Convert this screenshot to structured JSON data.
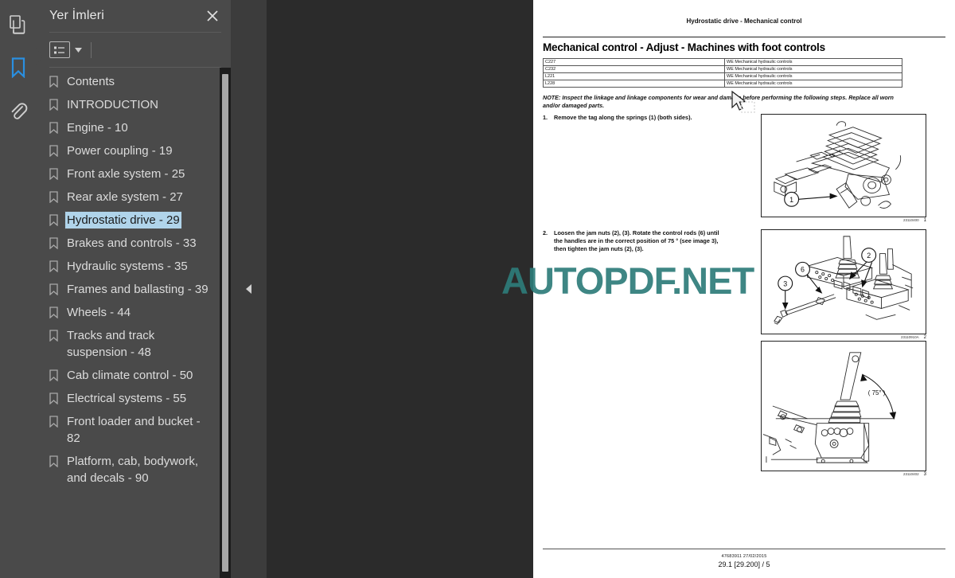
{
  "rail": {
    "items": [
      {
        "name": "pages-icon",
        "tooltip": "Sayfa Küçük Resimleri",
        "active": false
      },
      {
        "name": "bookmark-icon",
        "tooltip": "Yer İmleri",
        "active": true
      },
      {
        "name": "attachment-icon",
        "tooltip": "Ekler",
        "active": false
      }
    ]
  },
  "panel": {
    "title": "Yer İmleri",
    "close_label": "×",
    "toolbar": {
      "list_options_label": "",
      "caret_label": ""
    },
    "bookmarks": [
      {
        "label": "Contents",
        "selected": false
      },
      {
        "label": "INTRODUCTION",
        "selected": false
      },
      {
        "label": "Engine - 10",
        "selected": false
      },
      {
        "label": "Power coupling - 19",
        "selected": false
      },
      {
        "label": "Front axle system - 25",
        "selected": false
      },
      {
        "label": "Rear axle system - 27",
        "selected": false
      },
      {
        "label": "Hydrostatic drive - 29",
        "selected": true
      },
      {
        "label": "Brakes and controls - 33",
        "selected": false
      },
      {
        "label": "Hydraulic systems - 35",
        "selected": false
      },
      {
        "label": "Frames and ballasting - 39",
        "selected": false
      },
      {
        "label": "Wheels - 44",
        "selected": false
      },
      {
        "label": "Tracks and track suspension - 48",
        "selected": false
      },
      {
        "label": "Cab climate control - 50",
        "selected": false
      },
      {
        "label": "Electrical systems - 55",
        "selected": false
      },
      {
        "label": "Front loader and bucket - 82",
        "selected": false
      },
      {
        "label": "Platform, cab, bodywork, and decals - 90",
        "selected": false
      }
    ]
  },
  "document": {
    "running_head": "Hydrostatic drive - Mechanical control",
    "heading": "Mechanical control - Adjust - Machines with foot controls",
    "spec_table": {
      "rows": [
        {
          "model": "C227",
          "description": "WE Mechanical hydraulic controls"
        },
        {
          "model": "C232",
          "description": "WE Mechanical hydraulic controls"
        },
        {
          "model": "L221",
          "description": "WE Mechanical hydraulic controls"
        },
        {
          "model": "L228",
          "description": "WE Mechanical hydraulic controls"
        }
      ]
    },
    "note": "NOTE: Inspect the linkage and linkage components for wear and damage before performing the following steps. Replace all worn and/or damaged parts.",
    "steps": [
      {
        "number": "1.",
        "text": "Remove the tag along the springs (1) (both sides)."
      },
      {
        "number": "2.",
        "text": "Loosen the jam nuts (2), (3).  Rotate the control rods (6) until the handles are in the correct position of 75 ° (see image 3), then tighten the jam nuts (2), (3)."
      }
    ],
    "figures": [
      {
        "code": "23110400",
        "index": "1",
        "callouts": [
          "1"
        ]
      },
      {
        "code": "23110910A",
        "index": "2",
        "callouts": [
          "2",
          "3",
          "6"
        ]
      },
      {
        "code": "23110402",
        "index": "3",
        "callouts": [
          "75°"
        ]
      }
    ],
    "footer": {
      "line1": "47683911 27/02/2015",
      "line2": "29.1 [29.200] / 5"
    }
  },
  "watermark": {
    "text": "AUTOPDF.NET",
    "color": "#2e7c7a"
  },
  "collapse": {
    "label": "◀"
  },
  "cursor": {
    "name": "selection-cursor"
  }
}
